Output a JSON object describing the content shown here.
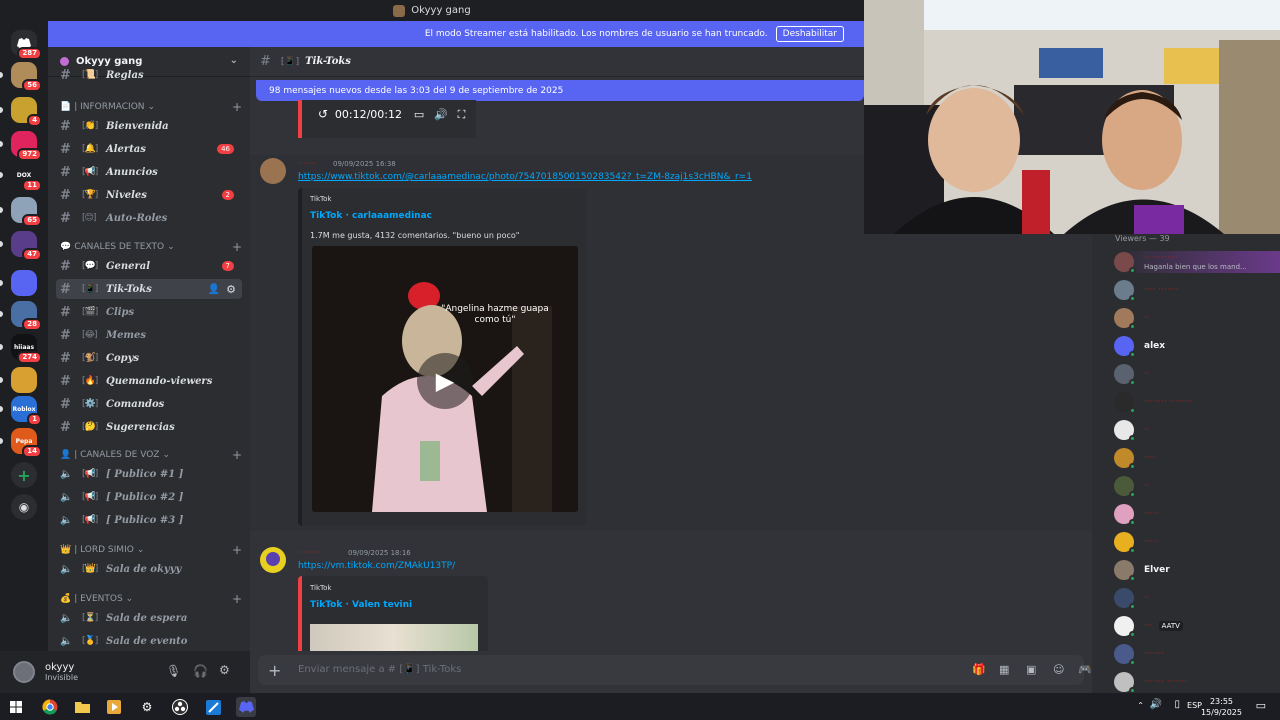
{
  "window": {
    "title": "Okyyy gang"
  },
  "banner": {
    "text": "El modo Streamer está habilitado. Los nombres de usuario se han truncado.",
    "button": "Deshabilitar"
  },
  "rail": {
    "home_badge": "287",
    "servers": [
      {
        "badge": "56",
        "color": "#b08c5a"
      },
      {
        "badge": "4",
        "color": "#c9a12f"
      },
      {
        "badge": "972",
        "color": "#e0245e"
      },
      {
        "label": "DOX",
        "badge": "11",
        "color": "#1e1f22"
      },
      {
        "badge": "65",
        "color": "#8fa3b8"
      },
      {
        "badge": "47",
        "color": "#5a3d8a"
      },
      {
        "badge": "",
        "color": "#5865f2"
      },
      {
        "badge": "28",
        "color": "#4a6fa5"
      },
      {
        "label": "hiiaas",
        "badge": "274",
        "color": "#111214"
      },
      {
        "badge": "",
        "color": "#d8a030"
      },
      {
        "label": "Roblox",
        "badge": "1",
        "color": "#2a6fd6"
      },
      {
        "label": "Pepa",
        "badge": "14",
        "color": "#e05a1c"
      }
    ]
  },
  "guild": {
    "name": "Okyyy gang"
  },
  "sidebar": {
    "partial": {
      "emoji": "📜",
      "name": "Reglas"
    },
    "categories": {
      "info": "| INFORMACION",
      "texto": "CANALES DE TEXTO",
      "voz": "| CANALES DE VOZ",
      "lord": "| LORD SIMIO",
      "eventos": "| EVENTOS"
    },
    "info_channels": [
      {
        "emoji": "[👏]",
        "name": "Bienvenida",
        "count": ""
      },
      {
        "emoji": "[🔔]",
        "name": "Alertas",
        "count": "46"
      },
      {
        "emoji": "[📢]",
        "name": "Anuncios",
        "count": ""
      },
      {
        "emoji": "[🏆]",
        "name": "Niveles",
        "count": "2"
      },
      {
        "emoji": "[😊]",
        "name": "Auto-Roles",
        "count": ""
      }
    ],
    "text_channels": [
      {
        "emoji": "[💬]",
        "name": "General",
        "count": "7"
      },
      {
        "emoji": "[📱]",
        "name": "Tik-Toks",
        "count": ""
      },
      {
        "emoji": "[🎬]",
        "name": "Clips",
        "count": ""
      },
      {
        "emoji": "[😂]",
        "name": "Memes",
        "count": ""
      },
      {
        "emoji": "[🐒]",
        "name": "Copys",
        "count": ""
      },
      {
        "emoji": "[🔥]",
        "name": "Quemando-viewers",
        "count": ""
      },
      {
        "emoji": "[⚙️]",
        "name": "Comandos",
        "count": ""
      },
      {
        "emoji": "[🤔]",
        "name": "Sugerencias",
        "count": ""
      }
    ],
    "voice_channels": [
      {
        "emoji": "[📢]",
        "name": "[ Publico #1 ]"
      },
      {
        "emoji": "[📢]",
        "name": "[ Publico #2 ]"
      },
      {
        "emoji": "[📢]",
        "name": "[ Publico #3 ]"
      }
    ],
    "lord_channels": [
      {
        "emoji": "[👑]",
        "name": "Sala de okyyy"
      }
    ],
    "event_channels": [
      {
        "emoji": "[⏳]",
        "name": "Sala de espera"
      },
      {
        "emoji": "[🥇]",
        "name": "Sala de evento"
      }
    ]
  },
  "user": {
    "name": "okyyy",
    "status": "Invisible"
  },
  "chat": {
    "channel_emoji": "[📱]",
    "channel_name": "Tik-Toks",
    "new_messages": "98 mensajes nuevos desde las 3:03 del 9 de septiembre de 2025",
    "video_time": "00:12/00:12",
    "messages": [
      {
        "author": "·······",
        "timestamp": "09/09/2025 16:38",
        "link": "https://www.tiktok.com/@carlaaamedinac/photo/7547018500150283542?_t=ZM-8zaj1s3cHBN&_r=1",
        "embed_provider": "TikTok",
        "embed_title": "TikTok · carlaaamedinac",
        "embed_desc": "1.7M me gusta, 4132 comentarios. \"bueno un poco\"",
        "caption": "\"Angelina hazme guapa como tú\""
      },
      {
        "author": "·········",
        "timestamp": "09/09/2025 18:16",
        "link": "https://vm.tiktok.com/ZMAkU13TP/",
        "embed_provider": "TikTok",
        "embed_title": "TikTok · Valen tevini"
      }
    ],
    "placeholder": "Enviar mensaje a # [📱] Tik-Toks"
  },
  "viewers": {
    "header": "Viewers — 39",
    "list": [
      {
        "name": "·· ·········",
        "sub": "Haganla bien que los mand...",
        "white": false,
        "color": "#7a4a4a"
      },
      {
        "name": "···· ·······",
        "white": false,
        "color": "#6b7d8c"
      },
      {
        "name": "··",
        "white": false,
        "color": "#a07a5a"
      },
      {
        "name": "alex",
        "white": true,
        "color": "#5865f2"
      },
      {
        "name": "··",
        "white": false,
        "color": "#5a6270"
      },
      {
        "name": "········ ········",
        "white": false,
        "color": "#2a2a2a"
      },
      {
        "name": "··",
        "white": false,
        "color": "#e8e8e8"
      },
      {
        "name": "····",
        "white": false,
        "color": "#c08a2a"
      },
      {
        "name": "··",
        "white": false,
        "color": "#4a5a3a"
      },
      {
        "name": "·····",
        "white": false,
        "color": "#e0a0c0"
      },
      {
        "name": "·····",
        "white": false,
        "color": "#e8b020"
      },
      {
        "name": "Elver",
        "white": true,
        "color": "#8a7a6a"
      },
      {
        "name": "··",
        "white": false,
        "color": "#3a4a6a"
      },
      {
        "name": "···",
        "white": false,
        "color": "#f0f0f0",
        "tag": "AATV"
      },
      {
        "name": "·······",
        "white": false,
        "color": "#4a5a8a"
      },
      {
        "name": "······· ·······",
        "white": false,
        "color": "#c0c0c0"
      }
    ]
  },
  "taskbar": {
    "lang": "ESP",
    "time": "23:55",
    "date": "15/9/2025"
  }
}
